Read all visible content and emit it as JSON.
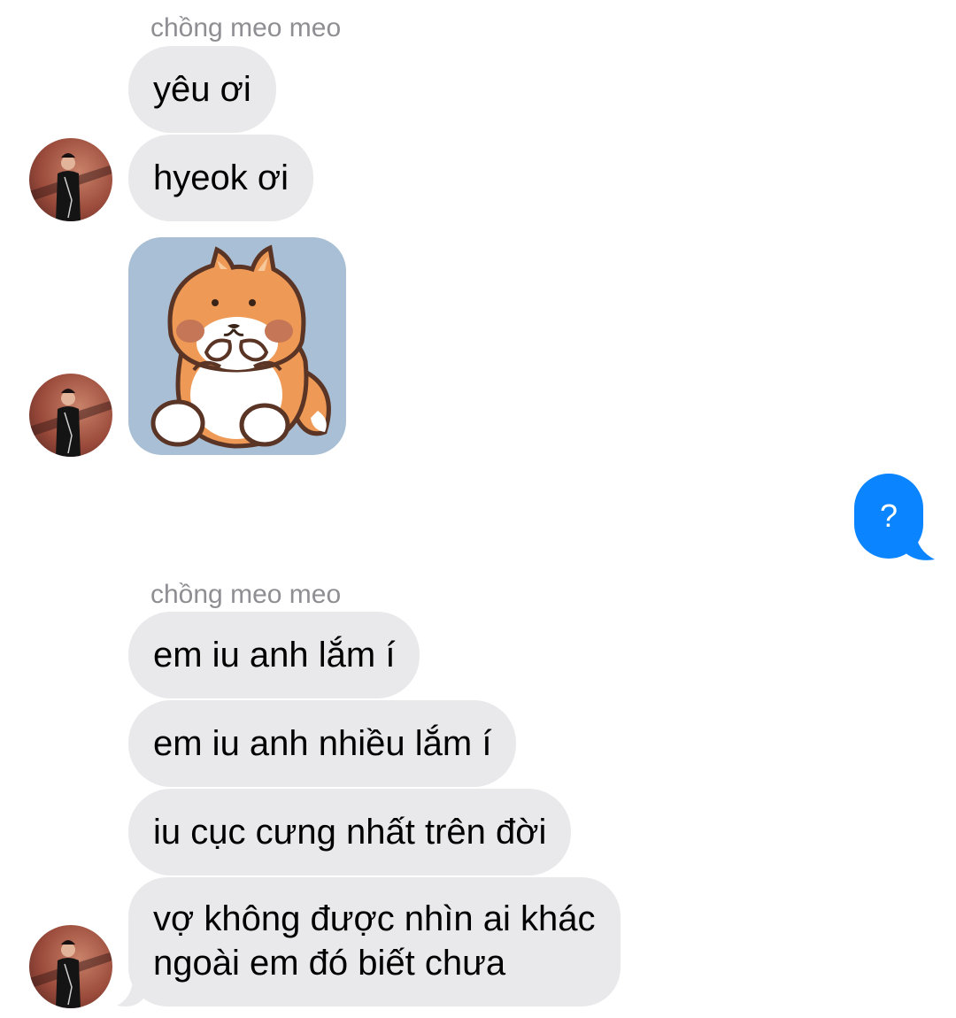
{
  "conversation": {
    "groups": [
      {
        "sender": "chồng meo meo",
        "messages": [
          "yêu ơi",
          "hyeok ơi"
        ]
      },
      {
        "sender": "chồng meo meo",
        "messages": [
          "em iu anh lắm í",
          "em iu anh nhiều lắm í",
          "iu cục cưng nhất trên đời"
        ],
        "last_message_lines": [
          "vợ không được nhìn ai khác",
          "ngoài em đó biết chưa"
        ]
      }
    ],
    "sticker": {
      "icon": "shiba-dog-sticker-icon",
      "background": "#a9bfd5"
    },
    "outgoing": {
      "text": "?",
      "color": "#0a84ff"
    },
    "incoming_bubble_color": "#e9e9eb"
  }
}
